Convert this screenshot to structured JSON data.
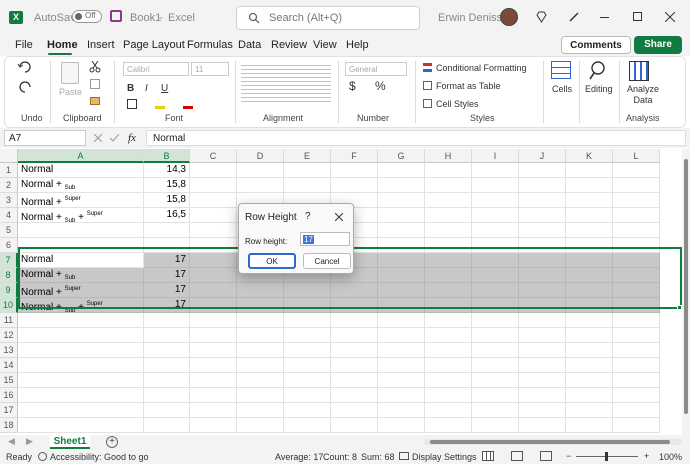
{
  "titlebar": {
    "autosave": "AutoSave",
    "toggle": "Off",
    "filename": "Book1",
    "separator": "-",
    "app": "Excel",
    "search_placeholder": "Search (Alt+Q)",
    "user": "Erwin Denissen"
  },
  "tabs": [
    "File",
    "Home",
    "Insert",
    "Page Layout",
    "Formulas",
    "Data",
    "Review",
    "View",
    "Help"
  ],
  "buttons": {
    "comments": "Comments",
    "share": "Share"
  },
  "ribbon": {
    "undo": "Undo",
    "clipboard": "Clipboard",
    "paste": "Paste",
    "font": "Font",
    "font_name": "Calibri",
    "font_size": "11",
    "alignment": "Alignment",
    "number": "Number",
    "number_format": "General",
    "styles": "Styles",
    "conditional": "Conditional Formatting",
    "format_table": "Format as Table",
    "cell_styles": "Cell Styles",
    "cells": "Cells",
    "editing": "Editing",
    "analyze": "Analyze Data",
    "analysis": "Analysis",
    "bold": "B",
    "italic": "I",
    "underline": "U",
    "currency": "$",
    "percent": "%"
  },
  "formula": {
    "namebox": "A7",
    "fx": "fx",
    "value": "Normal"
  },
  "columns": [
    "A",
    "B",
    "C",
    "D",
    "E",
    "F",
    "G",
    "H",
    "I",
    "J",
    "K",
    "L"
  ],
  "rows": [
    "1",
    "2",
    "3",
    "4",
    "5",
    "6",
    "7",
    "8",
    "9",
    "10",
    "11",
    "12",
    "13",
    "14",
    "15",
    "16",
    "17",
    "18"
  ],
  "cells": [
    {
      "row": 1,
      "a": "Normal",
      "b": "14,3"
    },
    {
      "row": 2,
      "a": "Normal + ",
      "a_sub": "Sub",
      "b": "15,8"
    },
    {
      "row": 3,
      "a": "Normal + ",
      "a_sup": "Super",
      "b": "15,8"
    },
    {
      "row": 4,
      "a": "Normal + ",
      "a_sub": "Sub",
      "a_mid": " + ",
      "a_sup": "Super",
      "b": "16,5"
    },
    {
      "row": 7,
      "a": "Normal",
      "b": "17"
    },
    {
      "row": 8,
      "a": "Normal + ",
      "a_sub": "Sub",
      "b": "17"
    },
    {
      "row": 9,
      "a": "Normal + ",
      "a_sup": "Super",
      "b": "17"
    },
    {
      "row": 10,
      "a": "Normal + ",
      "a_sub": "Sub",
      "a_mid": " + ",
      "a_sup": "Super",
      "b": "17"
    }
  ],
  "dialog": {
    "title": "Row Height",
    "help": "?",
    "label": "Row height:",
    "value": "17",
    "ok": "OK",
    "cancel": "Cancel"
  },
  "sheet": {
    "name": "Sheet1"
  },
  "status": {
    "ready": "Ready",
    "accessibility": "Accessibility: Good to go",
    "average": "Average: 17",
    "count": "Count: 8",
    "sum": "Sum: 68",
    "display": "Display Settings",
    "zoom": "100%"
  }
}
